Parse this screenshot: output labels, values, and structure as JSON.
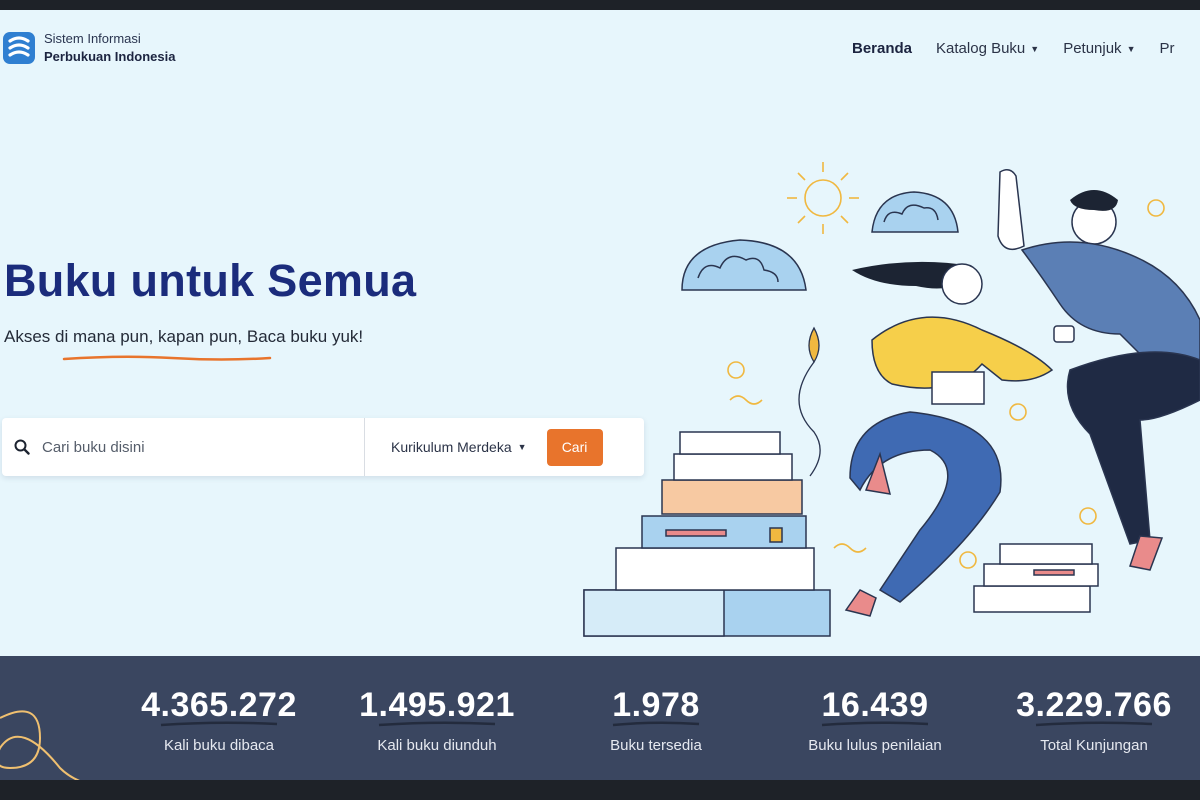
{
  "header": {
    "logo_line1": "Sistem Informasi",
    "logo_line2": "Perbukuan Indonesia",
    "nav": [
      {
        "label": "Beranda",
        "active": true,
        "has_caret": false
      },
      {
        "label": "Katalog Buku",
        "active": false,
        "has_caret": true
      },
      {
        "label": "Petunjuk",
        "active": false,
        "has_caret": true
      },
      {
        "label": "Pr",
        "active": false,
        "has_caret": false
      }
    ]
  },
  "hero": {
    "title": "Buku untuk Semua",
    "subtitle": "Akses di mana pun, kapan pun, Baca buku yuk!"
  },
  "search": {
    "placeholder": "Cari buku disini",
    "curriculum": "Kurikulum Merdeka",
    "button": "Cari"
  },
  "stats": [
    {
      "value": "4.365.272",
      "label": "Kali buku dibaca"
    },
    {
      "value": "1.495.921",
      "label": "Kali buku diunduh"
    },
    {
      "value": "1.978",
      "label": "Buku tersedia"
    },
    {
      "value": "16.439",
      "label": "Buku lulus penilaian"
    },
    {
      "value": "3.229.766",
      "label": "Total Kunjungan"
    }
  ],
  "colors": {
    "background": "#e7f6fc",
    "title": "#1b2c7c",
    "accent_orange": "#e8742c",
    "stats_band": "#3a4660"
  }
}
